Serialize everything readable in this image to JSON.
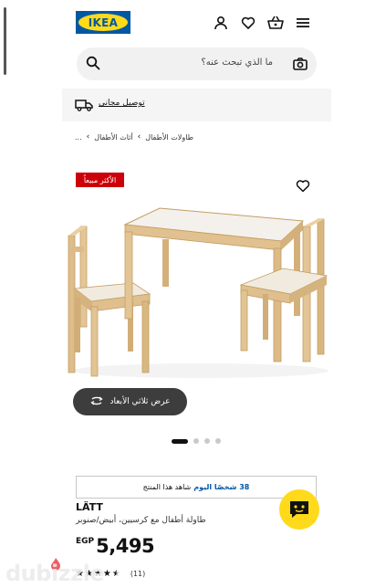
{
  "header": {
    "logo_text": "IKEA",
    "icons": [
      "user-icon",
      "heart-icon",
      "basket-icon",
      "menu-icon"
    ]
  },
  "search": {
    "placeholder": "ما الذي تبحث عنه؟"
  },
  "delivery": {
    "label": "توصيل مجاني"
  },
  "breadcrumb": {
    "items": [
      "...",
      "أثاث الأطفال",
      "طاولات الأطفال"
    ]
  },
  "product": {
    "badge": "الأكثر مبيعاً",
    "view_3d_label": "عرض ثلاثي الأبعاد",
    "image_dots": 4,
    "active_dot": 0,
    "viewers_strong": "38 شخصًا اليوم",
    "viewers_rest": "شاهد هذا المنتج",
    "name": "LÄTT",
    "description": "طاولة أطفال مع كرسيين، أبيض/صنوبر",
    "currency": "EGP",
    "price": "5,495",
    "rating_value": 4.5,
    "review_count": "(11)"
  },
  "watermark": {
    "brand": "dubizzle"
  },
  "colors": {
    "ikea_blue": "#0058a3",
    "ikea_yellow": "#ffda1a",
    "badge_red": "#cc0008",
    "viewers_blue": "#0058a3"
  }
}
